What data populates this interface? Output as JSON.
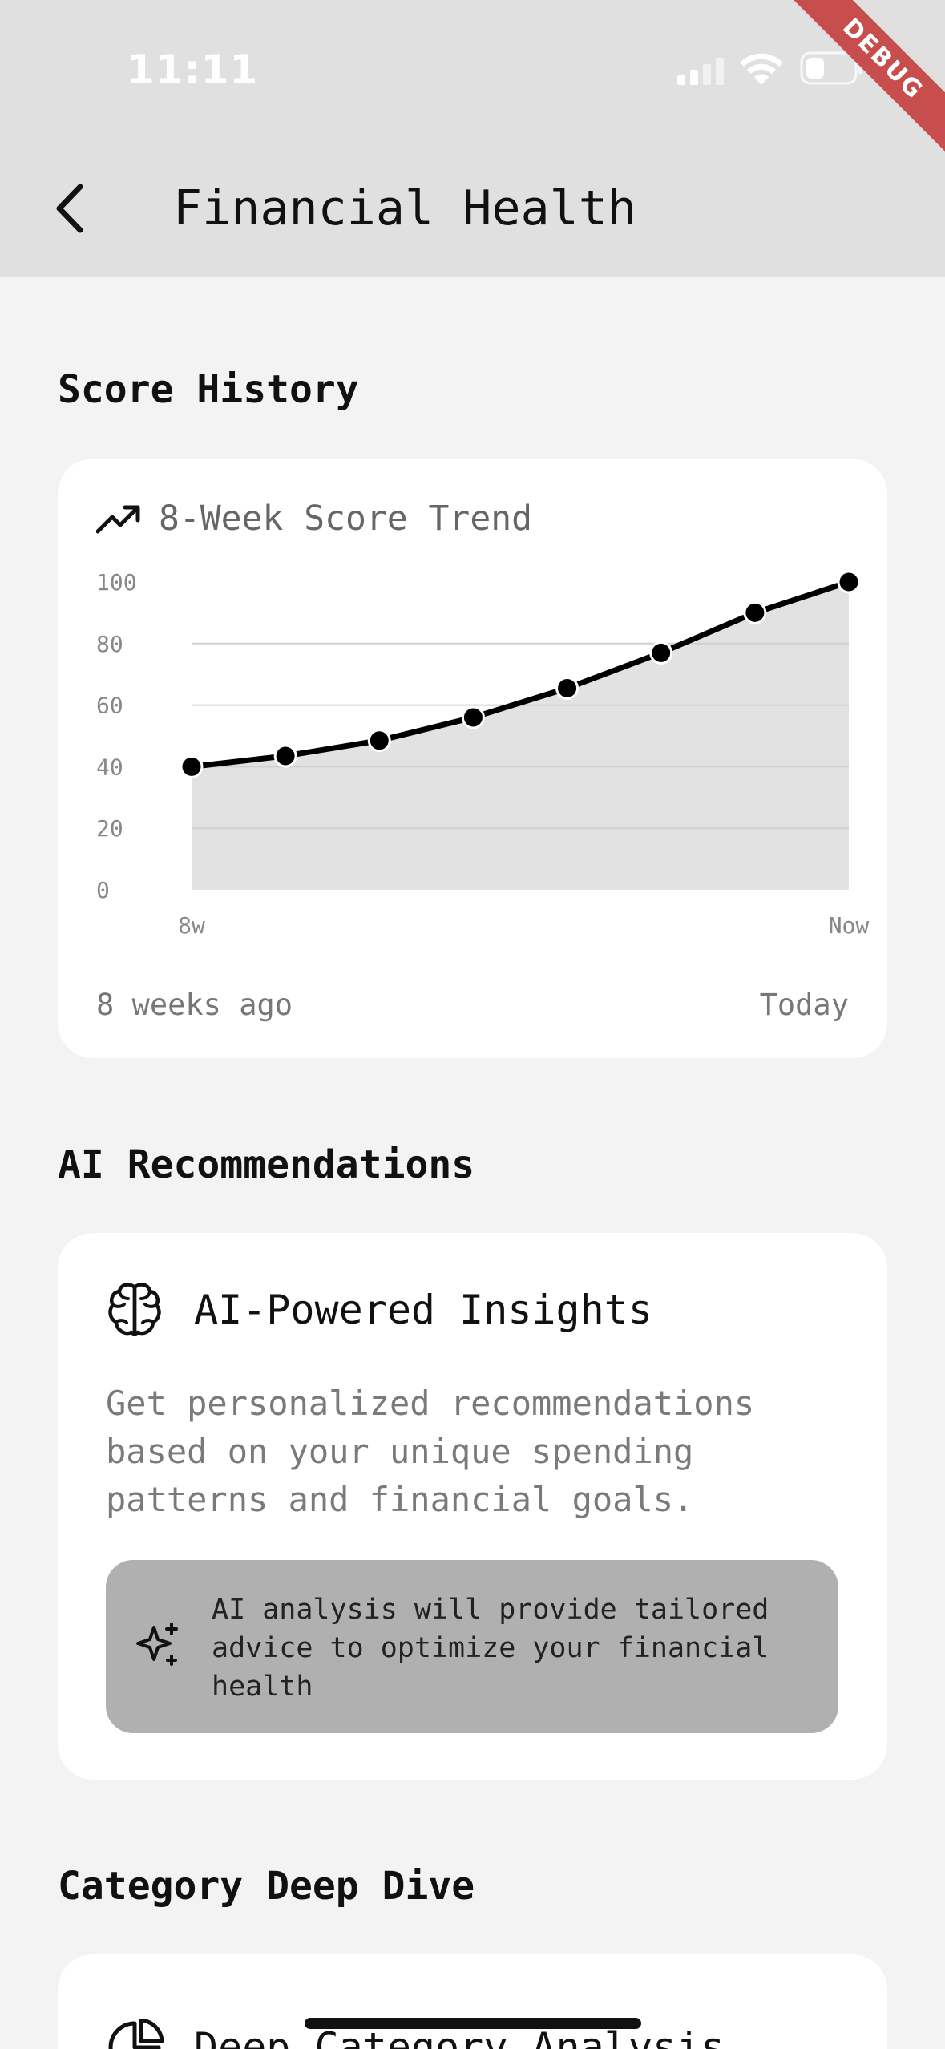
{
  "status_bar": {
    "time": "11:11",
    "icons": [
      "signal-icon",
      "wifi-icon",
      "battery-icon"
    ]
  },
  "debug_banner": "DEBUG",
  "header": {
    "back_icon": "chevron-left-icon",
    "title": "Financial Health"
  },
  "score_history": {
    "heading": "Score History",
    "card": {
      "icon": "trending-up-icon",
      "title": "8-Week Score Trend",
      "footer_left": "8 weeks ago",
      "footer_right": "Today"
    }
  },
  "chart_data": {
    "type": "area",
    "title": "8-Week Score Trend",
    "x": [
      "8w",
      "",
      "",
      "",
      "",
      "",
      "",
      "",
      "Now"
    ],
    "x_tick_labels": [
      "8w",
      "Now"
    ],
    "series": [
      {
        "values": [
          40,
          43.5,
          48.5,
          56,
          65.5,
          77,
          90,
          100
        ]
      }
    ],
    "y_ticks": [
      0,
      20,
      40,
      60,
      80,
      100
    ],
    "ylim": [
      0,
      100
    ],
    "grid": true,
    "colors": {
      "line": "#000000",
      "fill": "#e2e2e2",
      "grid": "#d0d0d0",
      "point": "#000000"
    }
  },
  "ai_recommendations": {
    "heading": "AI Recommendations",
    "card": {
      "icon": "brain-icon",
      "title": "AI-Powered Insights",
      "description": "Get personalized recommendations based on your unique spending patterns and financial goals.",
      "note_icon": "sparkles-icon",
      "note": "AI analysis will provide tailored advice to optimize your financial health"
    }
  },
  "category_deep_dive": {
    "heading": "Category Deep Dive",
    "card": {
      "icon": "pie-chart-icon",
      "title": "Deep Category Analysis"
    }
  }
}
